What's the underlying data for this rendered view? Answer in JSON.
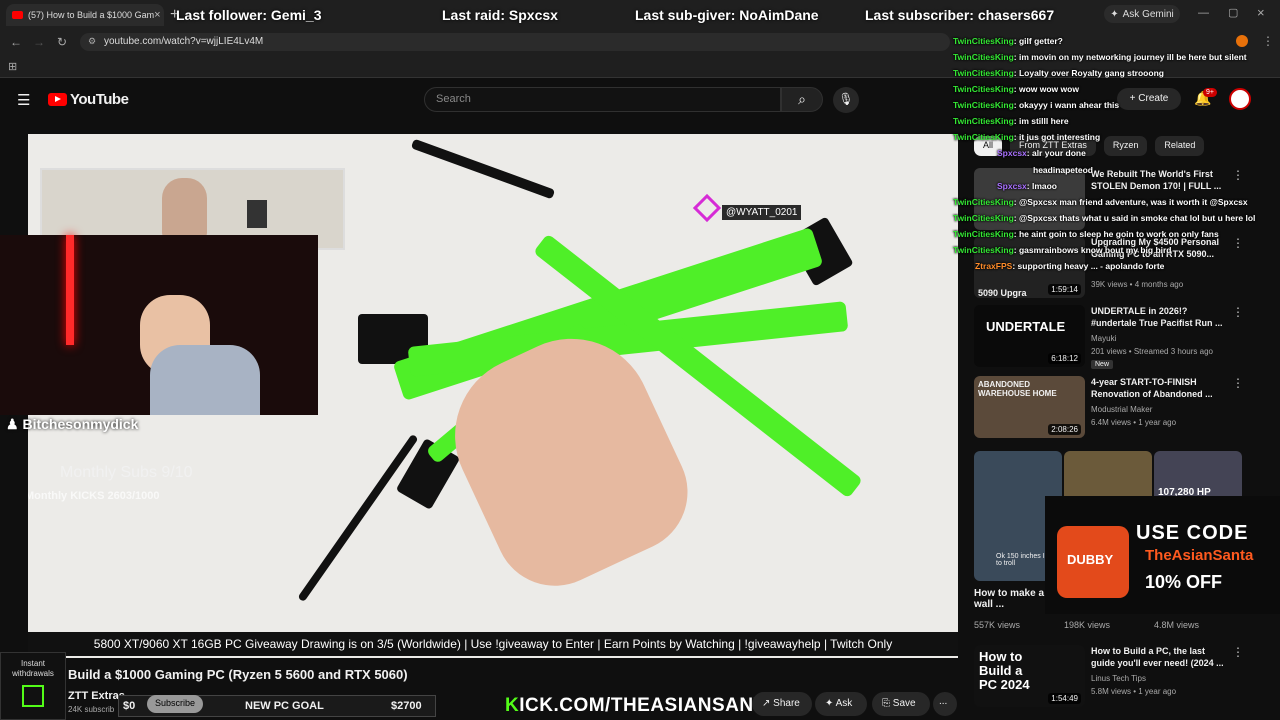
{
  "browser": {
    "tab_title": "(57) How to Build a $1000 Gam",
    "url": "youtube.com/watch?v=wjjLIE4Lv4M",
    "gemini_label": "Ask Gemini",
    "new_tab_symbol": "+"
  },
  "overlay_top": {
    "follower": "Last follower: Gemi_3",
    "raid": "Last raid: Spxcsx",
    "subgiver": "Last sub-giver: NoAimDane",
    "subscriber": "Last subscriber: chasers667"
  },
  "youtube": {
    "logo_text": "YouTube",
    "search_placeholder": "Search",
    "create_label": "Create",
    "notif_badge": "9+"
  },
  "video": {
    "streamer_name": "Bitchesonmydick",
    "monthly_subs": "Monthly Subs 9/10",
    "monthly_kicks": "Monthly KICKS 2603/1000",
    "name_tag": "@WYATT_0201",
    "ticker": "5800 XT/9060 XT 16GB PC Giveaway Drawing is on 3/5 (Worldwide) | Use !giveaway to Enter | Earn Points by Watching | !giveawayhelp | Twitch Only"
  },
  "info": {
    "title": "Build a $1000 Gaming PC (Ryzen 5 5600 and RTX 5060)",
    "channel": "ZTT Extras",
    "subs_count": "24K subscrib",
    "subscribe_label": "Subscribe",
    "goal_start": "$0",
    "goal_label": "NEW PC GOAL",
    "goal_end": "$2700",
    "kick_k": "K",
    "kick_rest": "ICK.COM/THEASIANSANTA",
    "share_label": "Share",
    "ask_label": "Ask",
    "save_label": "Save",
    "more_label": "..."
  },
  "chips": [
    "All",
    "From ZTT Extras",
    "Ryzen",
    "Related"
  ],
  "recommendations": [
    {
      "title": "We Rebuilt The World's First STOLEN Demon 170! | FULL ...",
      "channel": "",
      "meta": "",
      "duration": ""
    },
    {
      "title": "Upgrading My $4500 Personal Gaming PC to an RTX 5090...",
      "channel": "",
      "meta": "39K views • 4 months ago",
      "duration": "1:59:14",
      "thumb_text": "5090 Upgra"
    },
    {
      "title": "UNDERTALE in 2026!? #undertale True Pacifist Run ...",
      "channel": "Mayuki",
      "meta": "201 views • Streamed 3 hours ago",
      "duration": "6:18:12",
      "badge": "New",
      "thumb_text": "UNDERTALE"
    },
    {
      "title": "4-year START-TO-FINISH Renovation of Abandoned ...",
      "channel": "Modustrial Maker",
      "meta": "6.4M views • 1 year ago",
      "duration": "2:08:26",
      "thumb_text": "ABANDONED WAREHOUSE HOME"
    },
    {
      "title": "How to Build a PC, the last guide you'll ever need! (2024 ...",
      "channel": "Linus Tech Tips",
      "meta": "5.8M views • 1 year ago",
      "duration": "1:54:49",
      "thumb_text": "How to Build a PC 2024"
    }
  ],
  "shorts": [
    {
      "title": "How to make a tv wall ...",
      "views": "557K views",
      "thumb_text": "Ok 150 inches I like to troll"
    },
    {
      "title": "",
      "views": "198K views"
    },
    {
      "title": "",
      "views": "4.8M views",
      "thumb_text": "107,280 HP"
    }
  ],
  "chat": [
    {
      "user": "TwinCitiesKing",
      "text": ": gilf getter?"
    },
    {
      "user": "TwinCitiesKing",
      "text": ": im movin on my networking journey ill be here but silent"
    },
    {
      "user": "TwinCitiesKing",
      "text": ": Loyalty over Royalty gang strooong"
    },
    {
      "user": "TwinCitiesKing",
      "text": ": wow wow wow"
    },
    {
      "user": "TwinCitiesKing",
      "text": ": okayyy i wann ahear this"
    },
    {
      "user": "TwinCitiesKing",
      "text": ": im stilll here"
    },
    {
      "user": "TwinCitiesKing",
      "text": ": it jus got interesting"
    },
    {
      "user": "Spxcsx",
      "text": ": alr your done"
    },
    {
      "user": "",
      "text": "headinapeteod"
    },
    {
      "user": "Spxcsx",
      "text": ": lmaoo"
    },
    {
      "user": "TwinCitiesKing",
      "text": ": @Spxcsx man friend adventure, was it worth it @Spxcsx"
    },
    {
      "user": "TwinCitiesKing",
      "text": ": @Spxcsx thats what u said in smoke chat lol but u here lol"
    },
    {
      "user": "TwinCitiesKing",
      "text": ": he aint goin to sleep he goin to work on only fans"
    },
    {
      "user": "TwinCitiesKing",
      "text": ": gasmrainbows know bout my big bird"
    },
    {
      "user": "ZtraxFPS",
      "text": ": supporting heavy ... - apolando forte"
    }
  ],
  "ad": {
    "line1": "USE CODE",
    "line2": "TheAsianSanta",
    "line3": "10% OFF",
    "brand": "DUBBY"
  },
  "instant": {
    "text": "Instant withdrawals"
  },
  "colors": {
    "accent_red": "#ff0000",
    "kick_green": "#53fc18",
    "cable_green": "#4fef28",
    "chat_user": "#34e834"
  }
}
